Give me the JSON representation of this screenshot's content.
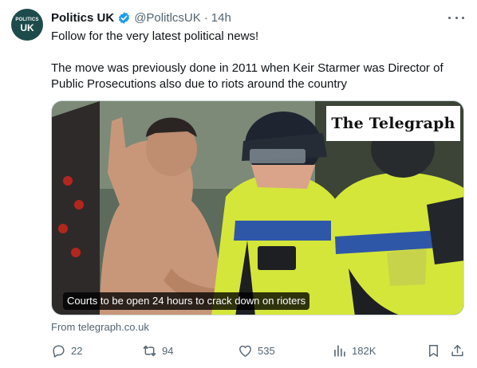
{
  "account": {
    "name": "Politics UK",
    "handle": "@PolitlcsUK",
    "separator": "·",
    "time": "14h",
    "avatar_line1": "POLITICS",
    "avatar_line2": "UK"
  },
  "tweet": {
    "text": "Follow for the very latest political news!\n\nThe move was previously done in 2011 when Keir Starmer was Director of Public Prosecutions also due to riots around the country"
  },
  "media": {
    "publisher_logo": "The Telegraph",
    "caption": "Courts to be open 24 hours to crack down on rioters",
    "source_label": "From telegraph.co.uk"
  },
  "actions": {
    "replies": "22",
    "reposts": "94",
    "likes": "535",
    "views": "182K"
  },
  "colors": {
    "secondary_text": "#536471",
    "verified_blue": "#1d9bf0",
    "avatar_bg": "#1d4b4b",
    "hi_vis_yellow": "#d4e63a"
  },
  "icons": [
    "more-icon",
    "verified-badge-icon",
    "reply-icon",
    "repost-icon",
    "like-icon",
    "views-icon",
    "bookmark-icon",
    "share-icon"
  ]
}
